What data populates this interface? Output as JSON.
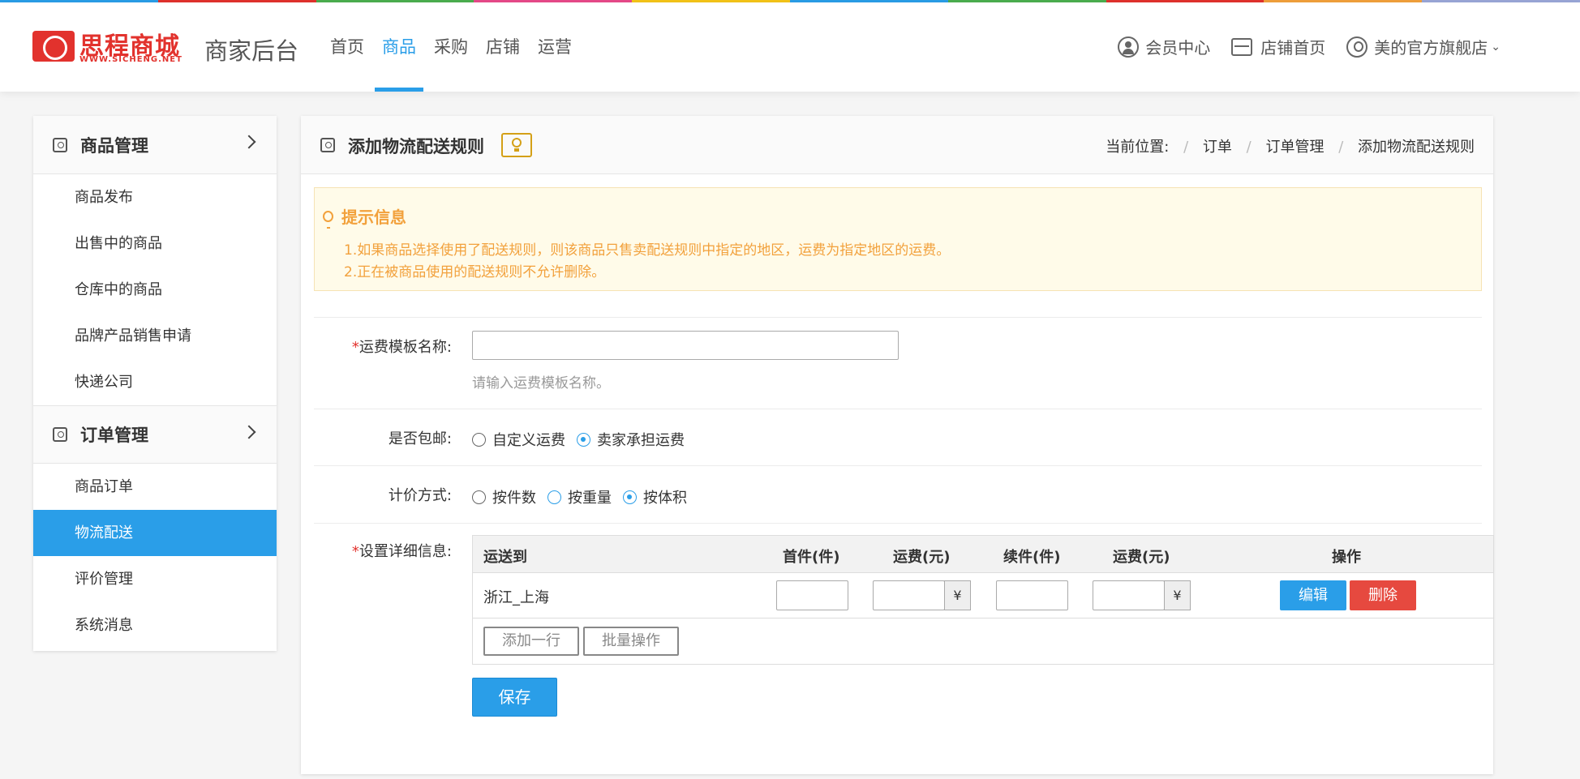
{
  "colors": {
    "stripe": [
      "#2a9ee8",
      "#e2322d",
      "#4caf50",
      "#e84a8a",
      "#f5c518",
      "#2a9ee8",
      "#4caf50",
      "#e2322d",
      "#f2a13c",
      "#9aa7d8"
    ],
    "accent": "#2a9ee8",
    "danger": "#e6493f",
    "tip": "#f2a13c",
    "brand": "#e2322d"
  },
  "header": {
    "logo_text": "思程商城",
    "logo_sub": "WWW.SICHENG.NET",
    "title": "商家后台",
    "nav": [
      "首页",
      "商品",
      "采购",
      "店铺",
      "运营"
    ],
    "nav_active": "商品",
    "member": "会员中心",
    "store_home": "店铺首页",
    "store_name": "美的官方旗舰店"
  },
  "sidebar": {
    "group1": {
      "title": "商品管理",
      "items": [
        "商品发布",
        "出售中的商品",
        "仓库中的商品",
        "品牌产品销售申请",
        "快递公司"
      ]
    },
    "group2": {
      "title": "订单管理",
      "items": [
        "商品订单",
        "物流配送",
        "评价管理",
        "系统消息"
      ]
    },
    "active": "物流配送"
  },
  "main": {
    "title": "添加物流配送规则",
    "breadcrumb": {
      "label": "当前位置:",
      "items": [
        "订单",
        "订单管理",
        "添加物流配送规则"
      ],
      "sep": "/"
    },
    "tip": {
      "title": "提示信息",
      "lines": [
        "1.如果商品选择使用了配送规则，则该商品只售卖配送规则中指定的地区，运费为指定地区的运费。",
        "2.正在被商品使用的配送规则不允许删除。"
      ]
    },
    "form": {
      "template_label": "运费模板名称:",
      "template_value": "",
      "template_hint": "请输入运费模板名称。",
      "free_label": "是否包邮:",
      "free_options": [
        "自定义运费",
        "卖家承担运费"
      ],
      "free_selected": "卖家承担运费",
      "price_label": "计价方式:",
      "price_options": [
        "按件数",
        "按重量",
        "按体积"
      ],
      "price_selected": "按体积",
      "detail_label": "设置详细信息:",
      "required_mark": "*"
    },
    "table": {
      "headers": [
        "运送到",
        "首件(件)",
        "运费(元)",
        "续件(件)",
        "运费(元)",
        "操作"
      ],
      "rows": [
        {
          "region": "浙江_上海",
          "first": "",
          "first_fee": "",
          "next": "",
          "next_fee": "",
          "currency": "¥"
        }
      ],
      "edit": "编辑",
      "delete": "删除",
      "add_row": "添加一行",
      "batch": "批量操作"
    },
    "save": "保存"
  }
}
